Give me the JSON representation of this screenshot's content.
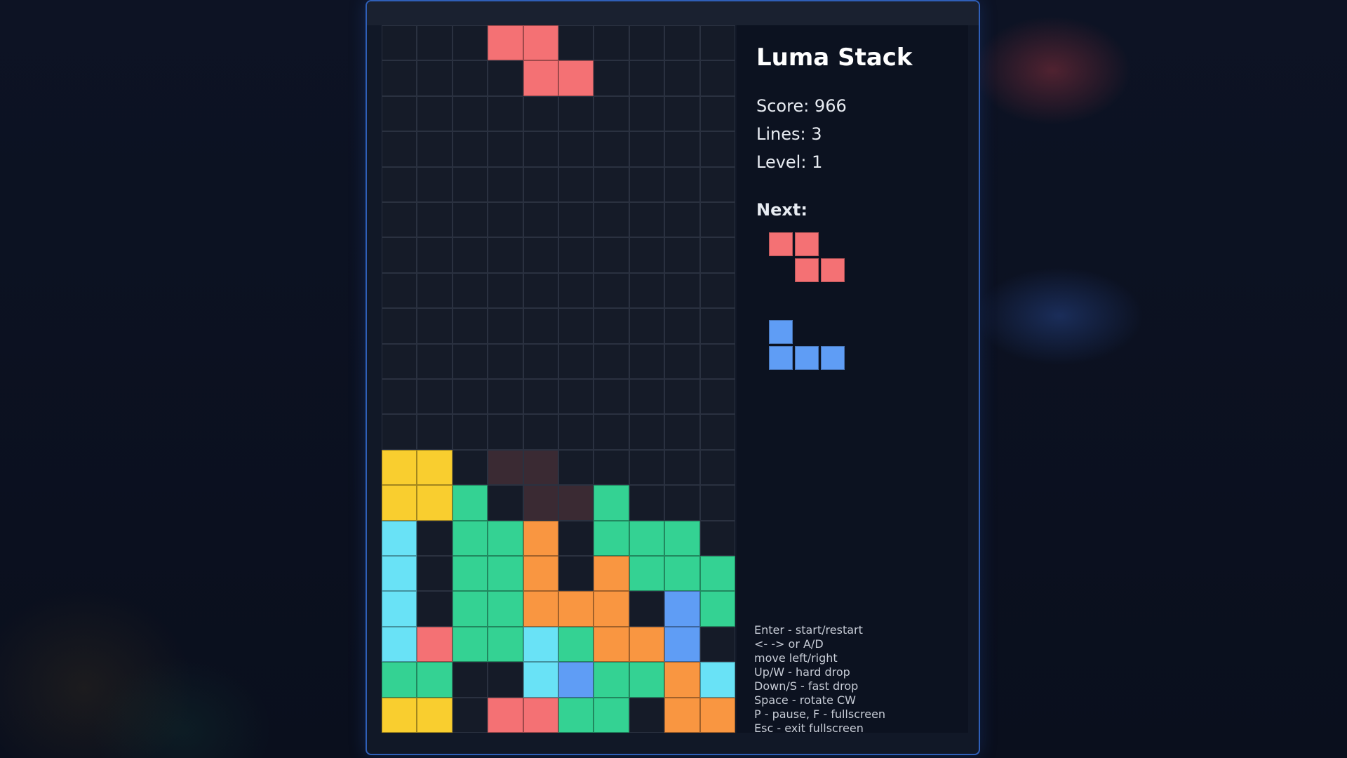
{
  "game": {
    "title": "Luma Stack",
    "score_label": "Score: 966",
    "lines_label": "Lines: 3",
    "level_label": "Level: 1",
    "next_label": "Next:"
  },
  "colors": {
    "Z": "#f47174",
    "O": "#f9ce2f",
    "S": "#34d293",
    "I": "#69e2f6",
    "L": "#f99641",
    "J": "#5f9df5",
    "ghost": "#3a2a33",
    "empty": "#151b28",
    "grid_line": "#2a3140"
  },
  "board": {
    "cols": 10,
    "rows": 20,
    "active_piece": {
      "type": "Z",
      "cells": [
        [
          3,
          0
        ],
        [
          4,
          0
        ],
        [
          4,
          1
        ],
        [
          5,
          1
        ]
      ]
    },
    "ghost_cells": [
      [
        3,
        12
      ],
      [
        4,
        12
      ],
      [
        4,
        13
      ],
      [
        5,
        13
      ]
    ],
    "locked_rows": [
      {
        "row": 12,
        "cells": "OO........"
      },
      {
        "row": 13,
        "cells": "OOS...S..."
      },
      {
        "row": 14,
        "cells": "I.SSL.SSS."
      },
      {
        "row": 15,
        "cells": "I.SSL.LSSS"
      },
      {
        "row": 16,
        "cells": "I.SSLLL.JS"
      },
      {
        "row": 17,
        "cells": "IZSSISLLJ."
      },
      {
        "row": 18,
        "cells": "SS..IJSSLI"
      },
      {
        "row": 19,
        "cells": "OO.ZZSS.LL"
      }
    ]
  },
  "next_pieces": [
    {
      "type": "Z",
      "cells": [
        [
          0,
          0
        ],
        [
          1,
          0
        ],
        [
          1,
          1
        ],
        [
          2,
          1
        ]
      ]
    },
    {
      "type": "J",
      "cells": [
        [
          0,
          0
        ],
        [
          0,
          1
        ],
        [
          1,
          1
        ],
        [
          2,
          1
        ]
      ]
    }
  ],
  "controls": [
    "Enter - start/restart",
    "<- -> or A/D",
    "move left/right",
    "Up/W - hard drop",
    "Down/S - fast drop",
    "Space - rotate CW",
    "P - pause, F - fullscreen",
    "Esc - exit fullscreen"
  ]
}
